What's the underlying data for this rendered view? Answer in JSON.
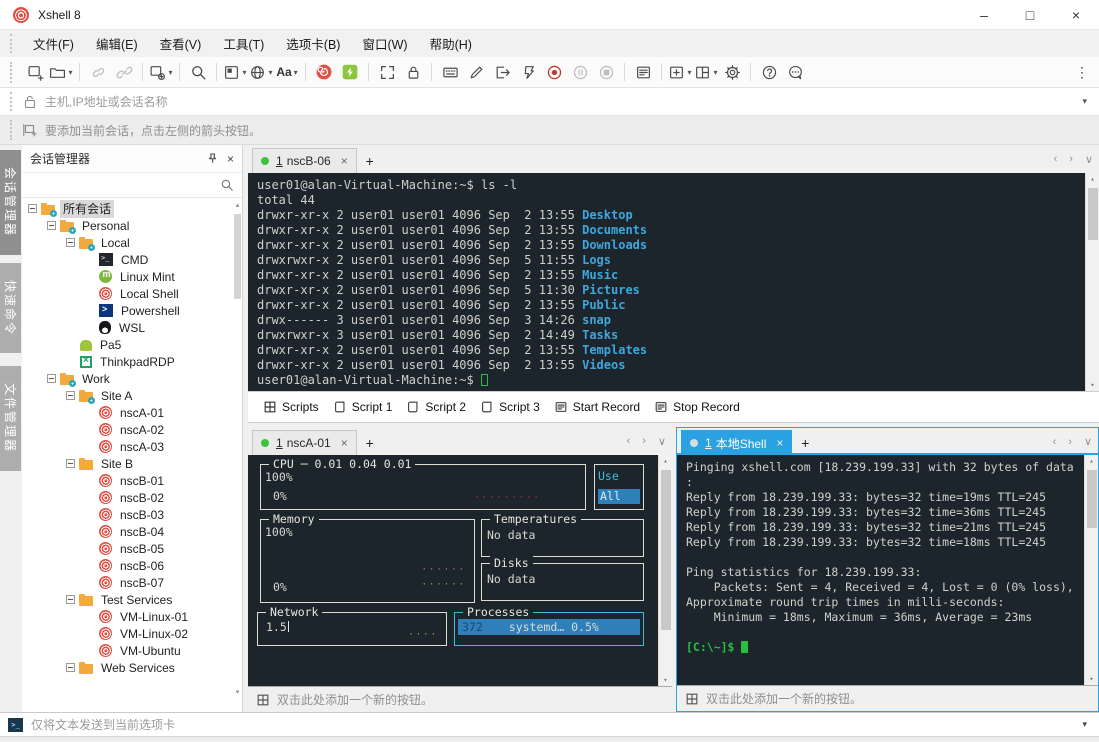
{
  "colors": {
    "accent_blue": "#2aa2e2",
    "terminal_bg": "#1d252c",
    "terminal_fg": "#cfd0c8",
    "directory_blue": "#3fa7dc",
    "prompt_green": "#25c040",
    "snail_red": "#e25045",
    "folder_orange": "#f3a93c",
    "status_green": "#3cc23c"
  },
  "window": {
    "title": "Xshell 8",
    "minimize": "–",
    "maximize": "□",
    "close": "×"
  },
  "menu": {
    "items": [
      "文件(F)",
      "编辑(E)",
      "查看(V)",
      "工具(T)",
      "选项卡(B)",
      "窗口(W)",
      "帮助(H)"
    ]
  },
  "toolbar": {
    "icons": [
      "new-session",
      "open-session",
      "disconnect",
      "reconnect",
      "session-properties",
      "find",
      "quick-transfer",
      "encoding-globe",
      "font",
      "xshell-home",
      "xftp",
      "fullscreen",
      "lock-screen",
      "virtual-keyboard",
      "compose",
      "send-input",
      "scroll-page",
      "record-start",
      "record-pause",
      "record-stop",
      "session-log",
      "new-tab",
      "tile-layout",
      "options-gear",
      "help",
      "feedback",
      "more"
    ],
    "font_label": "Aa",
    "more_glyph": "⋮"
  },
  "address_bar": {
    "placeholder": "主机,IP地址或会话名称",
    "caret": "▾"
  },
  "info_bar": {
    "text": "要添加当前会话，点击左侧的箭头按钮。"
  },
  "side_tabs": [
    {
      "label": "会话管理器",
      "active": true
    },
    {
      "label": "快速命令",
      "active": false
    },
    {
      "label": "文件管理器",
      "active": false
    }
  ],
  "session_panel": {
    "title": "会话管理器",
    "pin": "凸",
    "close": "×",
    "tree": [
      {
        "label": "所有会话",
        "icon": "folder-gear",
        "depth": 0,
        "expander": true,
        "selected": true
      },
      {
        "label": "Personal",
        "icon": "folder-gear",
        "depth": 1,
        "expander": true
      },
      {
        "label": "Local",
        "icon": "folder-gear",
        "depth": 2,
        "expander": true
      },
      {
        "label": "CMD",
        "icon": "cmd",
        "depth": 3
      },
      {
        "label": "Linux Mint",
        "icon": "mint",
        "depth": 3
      },
      {
        "label": "Local Shell",
        "icon": "snail",
        "depth": 3
      },
      {
        "label": "Powershell",
        "icon": "powershell",
        "depth": 3
      },
      {
        "label": "WSL",
        "icon": "wsl",
        "depth": 3
      },
      {
        "label": "Pa5",
        "icon": "android",
        "depth": 2
      },
      {
        "label": "ThinkpadRDP",
        "icon": "rdp",
        "depth": 2
      },
      {
        "label": "Work",
        "icon": "folder-gear",
        "depth": 1,
        "expander": true
      },
      {
        "label": "Site A",
        "icon": "folder-gear",
        "depth": 2,
        "expander": true
      },
      {
        "label": "nscA-01",
        "icon": "snail",
        "depth": 3
      },
      {
        "label": "nscA-02",
        "icon": "snail",
        "depth": 3
      },
      {
        "label": "nscA-03",
        "icon": "snail",
        "depth": 3
      },
      {
        "label": "Site B",
        "icon": "folder",
        "depth": 2,
        "expander": true
      },
      {
        "label": "nscB-01",
        "icon": "snail",
        "depth": 3
      },
      {
        "label": "nscB-02",
        "icon": "snail",
        "depth": 3
      },
      {
        "label": "nscB-03",
        "icon": "snail",
        "depth": 3
      },
      {
        "label": "nscB-04",
        "icon": "snail",
        "depth": 3
      },
      {
        "label": "nscB-05",
        "icon": "snail",
        "depth": 3
      },
      {
        "label": "nscB-06",
        "icon": "snail",
        "depth": 3
      },
      {
        "label": "nscB-07",
        "icon": "snail",
        "depth": 3
      },
      {
        "label": "Test Services",
        "icon": "folder",
        "depth": 2,
        "expander": true
      },
      {
        "label": "VM-Linux-01",
        "icon": "snail",
        "depth": 3
      },
      {
        "label": "VM-Linux-02",
        "icon": "snail",
        "depth": 3
      },
      {
        "label": "VM-Ubuntu",
        "icon": "snail",
        "depth": 3
      },
      {
        "label": "Web Services",
        "icon": "folder",
        "depth": 2,
        "expander": true
      }
    ]
  },
  "panes": {
    "top": {
      "tab": {
        "num": "1",
        "label": "nscB-06"
      },
      "terminal": [
        {
          "t": "user01@alan-Virtual-Machine:~$ ls -l"
        },
        {
          "t": "total 44"
        },
        {
          "m": "drwxr-xr-x 2 user01 user01 4096 Sep  2 13:55 ",
          "d": "Desktop"
        },
        {
          "m": "drwxr-xr-x 2 user01 user01 4096 Sep  2 13:55 ",
          "d": "Documents"
        },
        {
          "m": "drwxr-xr-x 2 user01 user01 4096 Sep  2 13:55 ",
          "d": "Downloads"
        },
        {
          "m": "drwxrwxr-x 2 user01 user01 4096 Sep  5 11:55 ",
          "d": "Logs"
        },
        {
          "m": "drwxr-xr-x 2 user01 user01 4096 Sep  2 13:55 ",
          "d": "Music"
        },
        {
          "m": "drwxr-xr-x 2 user01 user01 4096 Sep  5 11:30 ",
          "d": "Pictures"
        },
        {
          "m": "drwxr-xr-x 2 user01 user01 4096 Sep  2 13:55 ",
          "d": "Public"
        },
        {
          "m": "drwx------ 3 user01 user01 4096 Sep  3 14:26 ",
          "d": "snap"
        },
        {
          "m": "drwxrwxr-x 3 user01 user01 4096 Sep  2 14:49 ",
          "d": "Tasks"
        },
        {
          "m": "drwxr-xr-x 2 user01 user01 4096 Sep  2 13:55 ",
          "d": "Templates"
        },
        {
          "m": "drwxr-xr-x 2 user01 user01 4096 Sep  2 13:55 ",
          "d": "Videos"
        },
        {
          "t": "user01@alan-Virtual-Machine:~$ ",
          "cursor": "hollow"
        }
      ]
    },
    "scripts_bar": {
      "buttons": [
        {
          "icon": "grid",
          "label": "Scripts"
        },
        {
          "icon": "page",
          "label": "Script 1"
        },
        {
          "icon": "page",
          "label": "Script 2"
        },
        {
          "icon": "page",
          "label": "Script 3"
        },
        {
          "icon": "list",
          "label": "Start Record"
        },
        {
          "icon": "list",
          "label": "Stop Record"
        }
      ]
    },
    "bottom_left": {
      "tab": {
        "num": "1",
        "label": "nscA-01"
      },
      "dashboard": {
        "cpu_title": "CPU ─ 0.01 0.04 0.01",
        "cpu_max": "100%",
        "cpu_min": "0%",
        "use_label": "Use",
        "all_label": "All",
        "mem_title": "Memory",
        "mem_max": "100%",
        "mem_min": "0%",
        "temp_title": "Temperatures",
        "temp_value": "No data",
        "disk_title": "Disks",
        "disk_value": "No data",
        "net_title": "Network",
        "net_value": "1.5",
        "proc_title": "Processes",
        "proc_pid": "372",
        "proc_name": "systemd… 0.5%"
      },
      "quick_bar": "双击此处添加一个新的按钮。"
    },
    "bottom_right": {
      "tab": {
        "num": "1",
        "label": "本地Shell"
      },
      "terminal": [
        "Pinging xshell.com [18.239.199.33] with 32 bytes of data",
        ":",
        "Reply from 18.239.199.33: bytes=32 time=19ms TTL=245",
        "Reply from 18.239.199.33: bytes=32 time=36ms TTL=245",
        "Reply from 18.239.199.33: bytes=32 time=21ms TTL=245",
        "Reply from 18.239.199.33: bytes=32 time=18ms TTL=245",
        "",
        "Ping statistics for 18.239.199.33:",
        "    Packets: Sent = 4, Received = 4, Lost = 0 (0% loss),",
        "Approximate round trip times in milli-seconds:",
        "    Minimum = 18ms, Maximum = 36ms, Average = 23ms",
        ""
      ],
      "prompt": "[C:\\~]$ ",
      "quick_bar": "双击此处添加一个新的按钮。"
    }
  },
  "send_bar": {
    "placeholder": "仅将文本发送到当前选项卡",
    "caret": "▾",
    "icon_glyph": ">_"
  }
}
